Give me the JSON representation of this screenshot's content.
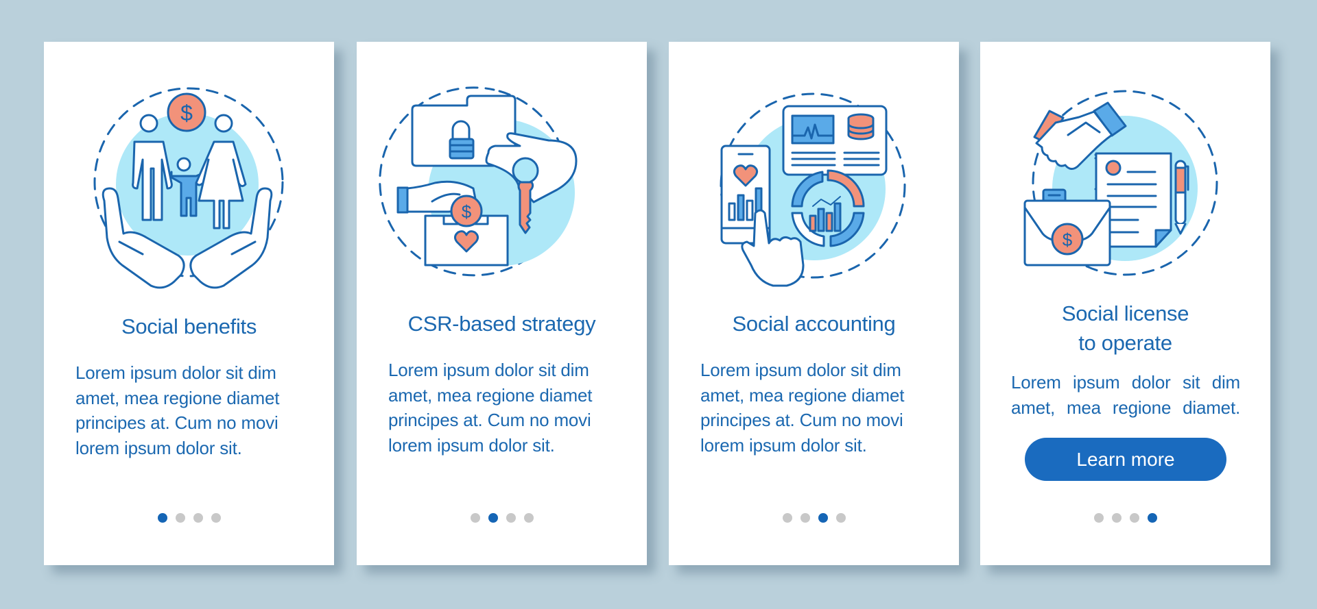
{
  "colors": {
    "background": "#bad0db",
    "card": "#ffffff",
    "text": "#1b68b0",
    "stroke": "#1a65ad",
    "light_fill": "#aee8f8",
    "accent": "#f2927a",
    "mid_blue": "#5aaae8",
    "dot_active": "#1565b5",
    "dot_inactive": "#c8c8c8",
    "button": "#1a6bbf"
  },
  "cards": [
    {
      "title": "Social benefits",
      "body": "Lorem ipsum dolor sit dim\namet, mea regione diamet\nprincipes at. Cum no movi\nlorem ipsum dolor sit.",
      "illustration": "family-in-hands-with-dollar-icon",
      "active_page": 1,
      "page_count": 4
    },
    {
      "title": "CSR-based strategy",
      "body": "Lorem ipsum dolor sit dim\namet, mea regione diamet\nprincipes at. Cum no movi\nlorem ipsum dolor sit.",
      "illustration": "locked-folder-donation-key-icon",
      "active_page": 2,
      "page_count": 4
    },
    {
      "title": "Social accounting",
      "body": "Lorem ipsum dolor sit dim\namet, mea regione diamet\nprincipes at. Cum no movi\nlorem ipsum dolor sit.",
      "illustration": "phone-dashboard-analytics-icon",
      "active_page": 3,
      "page_count": 4
    },
    {
      "title_line1": "Social license",
      "title_line2": "to operate",
      "body": "Lorem ipsum dolor sit dim\namet, mea regione diamet.",
      "illustration": "handshake-briefcase-contract-icon",
      "button_label": "Learn more",
      "active_page": 4,
      "page_count": 4
    }
  ]
}
